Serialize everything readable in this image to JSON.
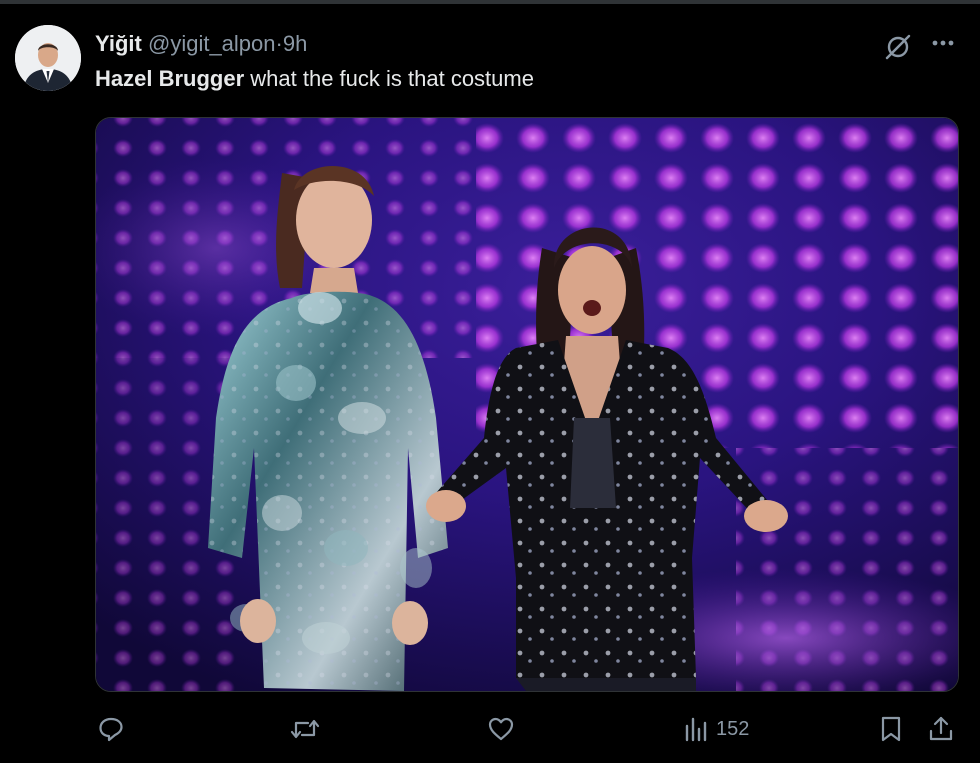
{
  "tweet": {
    "author_name": "Yiğit",
    "author_handle": "@yigit_alpon",
    "separator": "·",
    "time": "9h",
    "mention": "Hazel Brugger",
    "text": " what the fuck is that costume"
  },
  "actions": {
    "views_count": "152"
  },
  "colors": {
    "background": "#000000",
    "text_primary": "#e7e9ea",
    "text_secondary": "#8b98a5",
    "stage_purple": "#8b2fd6"
  },
  "icons": {
    "grok": "grok-icon",
    "more": "more-icon",
    "reply": "reply-icon",
    "retweet": "retweet-icon",
    "like": "like-icon",
    "views": "views-icon",
    "bookmark": "bookmark-icon",
    "share": "share-icon"
  }
}
